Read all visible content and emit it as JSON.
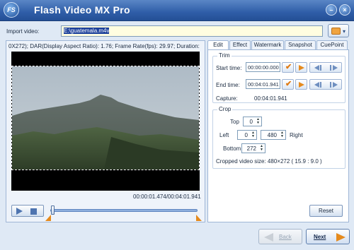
{
  "window": {
    "logo_text": "FS",
    "title": "Flash Video MX Pro",
    "minimize_glyph": "–",
    "close_glyph": "×"
  },
  "import": {
    "label": "Import video:",
    "value": "E:\\guatemala.m4v"
  },
  "preview": {
    "info_text": "0X272);  DAR(Display Aspect Ratio): 1.76;  Frame Rate(fps): 29.97;  Duration:",
    "time_display": "00:00:01.474/00:04:01.941",
    "playback_position": 0.006
  },
  "tabs": [
    {
      "label": "Edit",
      "active": true
    },
    {
      "label": "Effect",
      "active": false
    },
    {
      "label": "Watermark",
      "active": false
    },
    {
      "label": "Snapshot",
      "active": false
    },
    {
      "label": "CuePoint",
      "active": false
    }
  ],
  "trim": {
    "title": "Trim",
    "start_label": "Start time:",
    "start_value": "00:00:00.000",
    "end_label": "End time:",
    "end_value": "00:04:01.941",
    "capture_label": "Capture:",
    "capture_value": "00:04:01.941"
  },
  "crop": {
    "title": "Crop",
    "top_label": "Top",
    "top_value": "0",
    "left_label": "Left",
    "left_value": "0",
    "right_value": "480",
    "right_label": "Right",
    "bottom_label": "Bottom",
    "bottom_value": "272",
    "cropped_size": "Cropped video size: 480×272 ( 15.9 : 9.0 )"
  },
  "buttons": {
    "reset": "Reset",
    "back": "Back",
    "next": "Next"
  },
  "colors": {
    "titlebar": "#2f5ea8",
    "accent_orange": "#e58a1d",
    "input_highlight": "#1b3f9a"
  }
}
